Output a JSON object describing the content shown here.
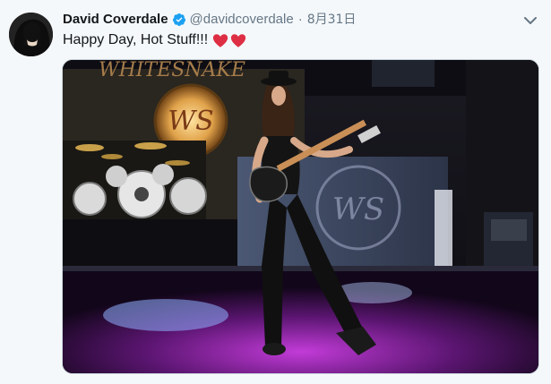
{
  "tweet": {
    "author_name": "David Coverdale",
    "handle": "@davidcoverdale",
    "separator": "·",
    "timestamp": "8月31日",
    "text": "Happy Day, Hot Stuff!!!",
    "emoji": [
      "red-heart",
      "red-heart"
    ]
  },
  "media": {
    "banner_text": "WHITESNAKE",
    "logo_text": "WS"
  },
  "colors": {
    "text_primary": "#14171a",
    "text_secondary": "#657786",
    "verified_blue": "#1da1f2",
    "heart_red": "#e0245e"
  }
}
